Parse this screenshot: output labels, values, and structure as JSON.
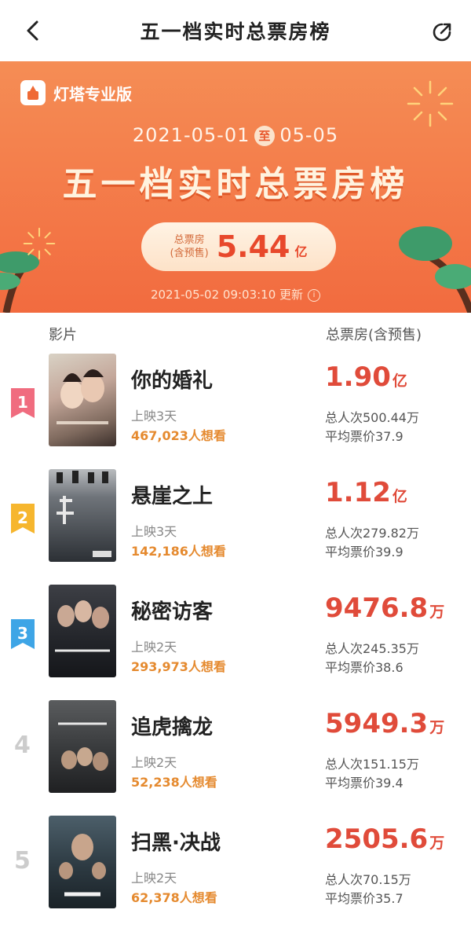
{
  "header": {
    "title": "五一档实时总票房榜"
  },
  "banner": {
    "brand": "灯塔专业版",
    "date_start": "2021-05-01",
    "date_sep": "至",
    "date_end": "05-05",
    "title": "五一档实时总票房榜",
    "total_label_1": "总票房",
    "total_label_2": "(含预售)",
    "total_value": "5.44",
    "total_unit": "亿",
    "updated": "2021-05-02 09:03:10 更新",
    "info_glyph": "i"
  },
  "columns": {
    "film": "影片",
    "box": "总票房(含预售)"
  },
  "colors": {
    "rank1": "#f06c7f",
    "rank2": "#f6b62e",
    "rank3": "#3ea5e6",
    "gross": "#e04b3a",
    "want": "#e58a2f"
  },
  "films": [
    {
      "rank": "1",
      "title": "你的婚礼",
      "days": "上映3天",
      "want": "467,023人想看",
      "gross": "1.90",
      "unit": "亿",
      "viewers": "总人次500.44万",
      "avg": "平均票价37.9"
    },
    {
      "rank": "2",
      "title": "悬崖之上",
      "days": "上映3天",
      "want": "142,186人想看",
      "gross": "1.12",
      "unit": "亿",
      "viewers": "总人次279.82万",
      "avg": "平均票价39.9"
    },
    {
      "rank": "3",
      "title": "秘密访客",
      "days": "上映2天",
      "want": "293,973人想看",
      "gross": "9476.8",
      "unit": "万",
      "viewers": "总人次245.35万",
      "avg": "平均票价38.6"
    },
    {
      "rank": "4",
      "title": "追虎擒龙",
      "days": "上映2天",
      "want": "52,238人想看",
      "gross": "5949.3",
      "unit": "万",
      "viewers": "总人次151.15万",
      "avg": "平均票价39.4"
    },
    {
      "rank": "5",
      "title": "扫黑·决战",
      "days": "上映2天",
      "want": "62,378人想看",
      "gross": "2505.6",
      "unit": "万",
      "viewers": "总人次70.15万",
      "avg": "平均票价35.7"
    }
  ]
}
